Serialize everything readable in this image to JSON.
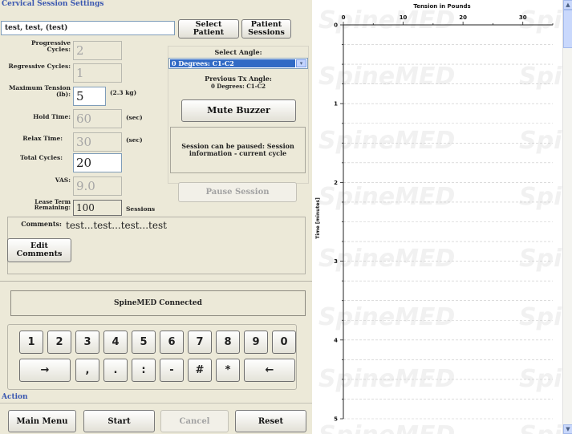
{
  "session_settings": {
    "title": "Cervical Session Settings",
    "patient_name": "test, test, (test)",
    "select_patient_label": "Select Patient",
    "patient_sessions_label": "Patient Sessions",
    "fields": {
      "progressive_cycles": {
        "label": "Progressive Cycles:",
        "value": "2"
      },
      "regressive_cycles": {
        "label": "Regressive Cycles:",
        "value": "1"
      },
      "maximum_tension": {
        "label": "Maximum Tension (lb):",
        "value": "5",
        "unit": "(2.3 kg)"
      },
      "hold_time": {
        "label": "Hold Time:",
        "value": "60",
        "unit": "(sec)"
      },
      "relax_time": {
        "label": "Relax Time:",
        "value": "30",
        "unit": "(sec)"
      },
      "total_cycles": {
        "label": "Total Cycles:",
        "value": "20"
      },
      "vas": {
        "label": "VAS:",
        "value": "9.0"
      },
      "lease_term": {
        "label": "Lease Term Remaining:",
        "value": "100",
        "unit": "Sessions"
      }
    },
    "select_angle": {
      "label": "Select Angle:",
      "value": "0 Degrees: C1-C2",
      "previous_label": "Previous Tx Angle:",
      "previous_value": "0 Degrees: C1-C2"
    },
    "mute_buzzer_label": "Mute Buzzer",
    "pause_message": "Session can be paused: Session information - current cycle",
    "pause_session_label": "Pause Session",
    "comments_label": "Comments:",
    "comments_text": "test...test...test...test",
    "edit_comments_label": "Edit Comments"
  },
  "status": {
    "text": "SpineMED Connected"
  },
  "numpad": {
    "row1": [
      "1",
      "2",
      "3",
      "4",
      "5",
      "6",
      "7",
      "8",
      "9",
      "0"
    ],
    "row2": [
      "→",
      ",",
      ".",
      ":",
      "-",
      "#",
      "*",
      "←"
    ]
  },
  "action": {
    "title": "Action",
    "main_menu_label": "Main Menu",
    "start_label": "Start",
    "cancel_label": "Cancel",
    "reset_label": "Reset"
  },
  "chart_data": {
    "type": "line",
    "xlabel": "Tension in Pounds",
    "ylabel": "Time [minutes]",
    "x_ticks": [
      0,
      10,
      20,
      30
    ],
    "y_ticks": [
      0,
      1,
      2,
      3,
      4,
      5
    ],
    "xlim": [
      0,
      35
    ],
    "ylim": [
      0,
      5
    ],
    "grid": true,
    "series": []
  },
  "watermark": "SpineMED"
}
